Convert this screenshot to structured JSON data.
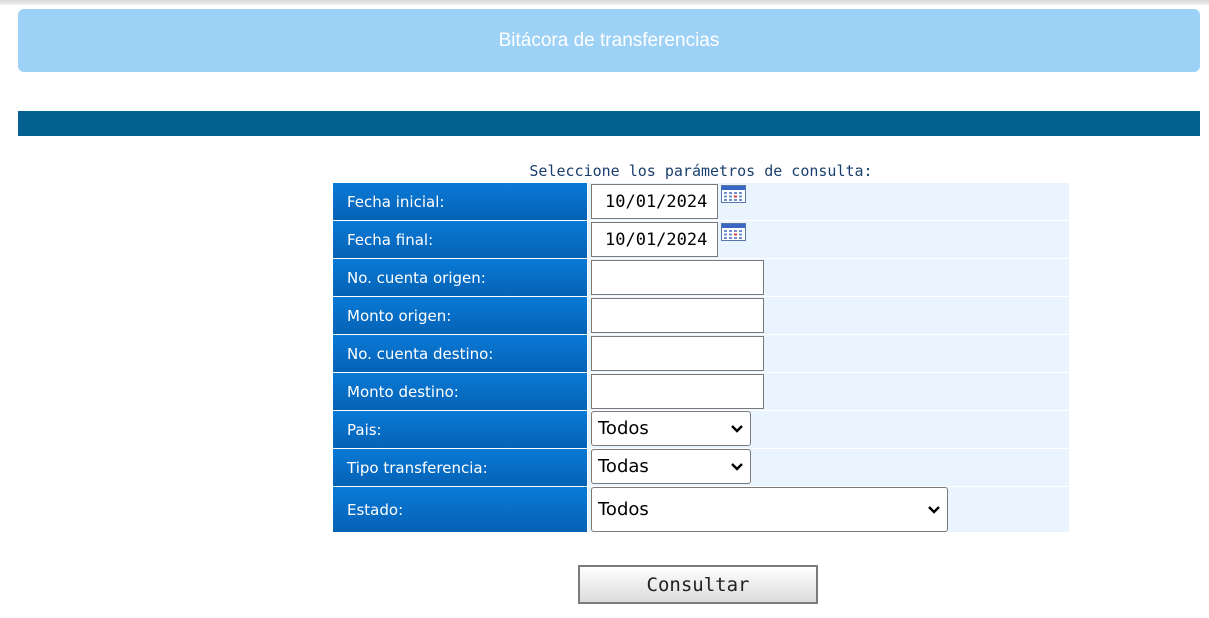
{
  "header": {
    "title": "Bitácora de transferencias"
  },
  "form": {
    "title": "Seleccione los parámetros de consulta:",
    "fields": {
      "fecha_inicial": {
        "label": "Fecha inicial:",
        "value": "10/01/2024"
      },
      "fecha_final": {
        "label": "Fecha final:",
        "value": "10/01/2024"
      },
      "cuenta_origen": {
        "label": "No. cuenta origen:",
        "value": ""
      },
      "monto_origen": {
        "label": "Monto origen:",
        "value": ""
      },
      "cuenta_destino": {
        "label": "No. cuenta destino:",
        "value": ""
      },
      "monto_destino": {
        "label": "Monto destino:",
        "value": ""
      },
      "pais": {
        "label": "Pais:",
        "selected": "Todos"
      },
      "tipo_transferencia": {
        "label": "Tipo transferencia:",
        "selected": "Todas"
      },
      "estado": {
        "label": "Estado:",
        "selected": "Todos"
      }
    },
    "submit_label": "Consultar"
  },
  "icons": {
    "calendar": "calendar-icon",
    "select_arrow": "chevron-down-icon"
  },
  "colors": {
    "banner": "#9dd1f5",
    "navy_bar": "#04608f",
    "label_bg": "#0a7ad6",
    "value_bg": "#eaf4ff",
    "form_title": "#1a3f6e"
  }
}
